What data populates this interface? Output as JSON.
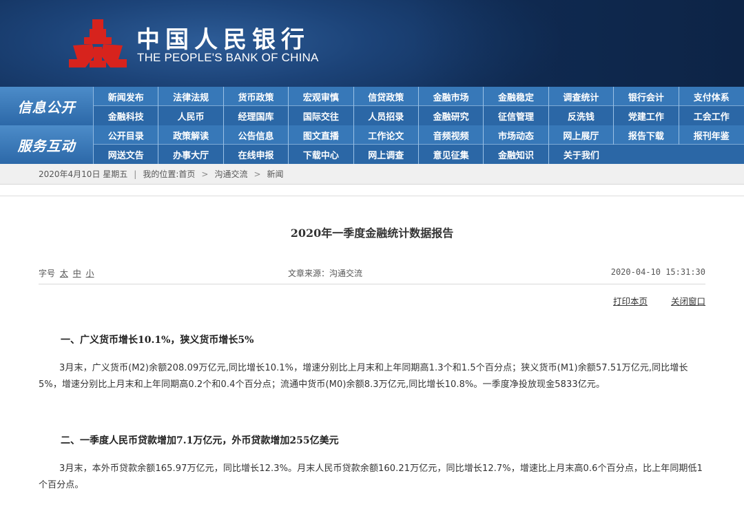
{
  "header": {
    "logo_cn": "中国人民银行",
    "logo_en": "THE PEOPLE'S BANK OF CHINA",
    "emblem_icon": "pboc-emblem-icon",
    "colors": {
      "banner": "#1c4378",
      "emblem": "#d7231d",
      "nav": "#2f6dae"
    }
  },
  "nav": {
    "info_label": "信息公开",
    "service_label": "服务互动",
    "info_row1": [
      "新闻发布",
      "法律法规",
      "货币政策",
      "宏观审慎",
      "信贷政策",
      "金融市场",
      "金融稳定",
      "调查统计",
      "银行会计",
      "支付体系"
    ],
    "info_row2": [
      "金融科技",
      "人民币",
      "经理国库",
      "国际交往",
      "人员招录",
      "金融研究",
      "征信管理",
      "反洗钱",
      "党建工作",
      "工会工作"
    ],
    "service_row1": [
      "公开目录",
      "政策解读",
      "公告信息",
      "图文直播",
      "工作论文",
      "音频视频",
      "市场动态",
      "网上展厅",
      "报告下载",
      "报刊年鉴"
    ],
    "service_row2": [
      "网送文告",
      "办事大厅",
      "在线申报",
      "下载中心",
      "网上调查",
      "意见征集",
      "金融知识",
      "关于我们"
    ]
  },
  "breadcrumb": {
    "date": "2020年4月10日",
    "weekday": "星期五",
    "sep": "|",
    "location_label": "我的位置:",
    "items": [
      "首页",
      "沟通交流",
      "新闻"
    ]
  },
  "article": {
    "title": "2020年一季度金融统计数据报告",
    "font_label": "字号",
    "font_sizes": [
      "太",
      "中",
      "小"
    ],
    "source": "文章来源：沟通交流",
    "timestamp": "2020-04-10 15:31:30",
    "print_label": "打印本页",
    "close_label": "关闭窗口",
    "sections": [
      {
        "heading": "一、广义货币增长10.1%，狭义货币增长5%",
        "body": "3月末，广义货币(M2)余额208.09万亿元,同比增长10.1%，增速分别比上月末和上年同期高1.3个和1.5个百分点；狭义货币(M1)余额57.51万亿元,同比增长5%，增速分别比上月末和上年同期高0.2个和0.4个百分点；流通中货币(M0)余额8.3万亿元,同比增长10.8%。一季度净投放现金5833亿元。"
      },
      {
        "heading": "二、一季度人民币贷款增加7.1万亿元，外币贷款增加255亿美元",
        "body": "3月末，本外币贷款余额165.97万亿元，同比增长12.3%。月末人民币贷款余额160.21万亿元，同比增长12.7%，增速比上月末高0.6个百分点，比上年同期低1个百分点。"
      }
    ]
  }
}
